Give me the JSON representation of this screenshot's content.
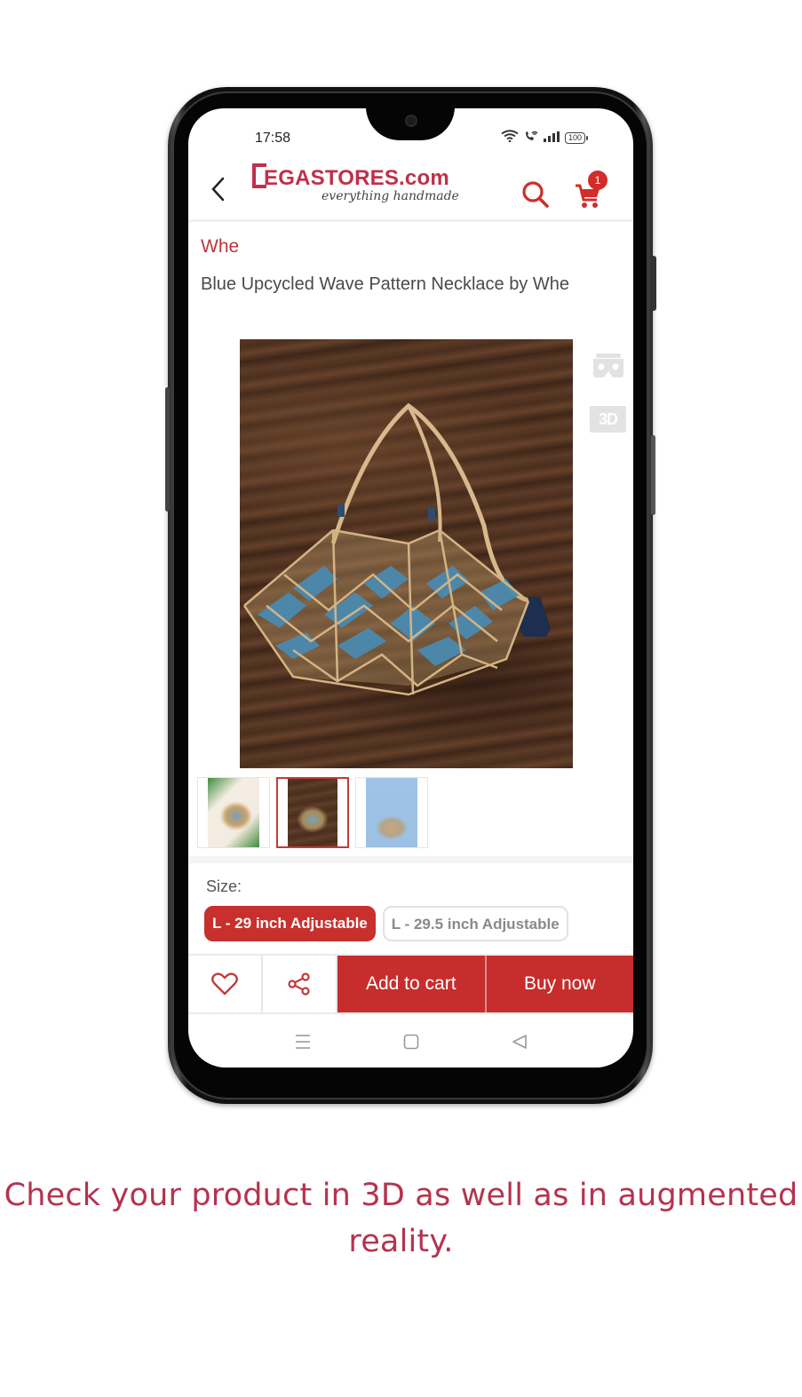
{
  "status_bar": {
    "time": "17:58",
    "battery": "100",
    "icons": [
      "wifi-icon",
      "wifi-calling-icon",
      "signal-icon",
      "battery-icon"
    ]
  },
  "header": {
    "logo_text": "EGASTORES.com",
    "logo_tagline": "everything handmade",
    "cart_count": "1",
    "icons": [
      "back-icon",
      "search-icon",
      "cart-icon"
    ]
  },
  "product": {
    "brand": "Whe",
    "title": "Blue Upcycled Wave Pattern Necklace by Whe",
    "image_description": "Blue and wood upcycled geometric wave-pattern necklace with tassel on a dark wood surface",
    "view_buttons": {
      "ar_icon": "vr-headset-icon",
      "three_d_label": "3D"
    },
    "thumbnails": [
      {
        "description": "Necklace on white background with green leaves",
        "selected": false
      },
      {
        "description": "Necklace on dark wood surface",
        "selected": true
      },
      {
        "description": "Necklace hanging on blue background",
        "selected": false
      }
    ]
  },
  "size": {
    "label": "Size:",
    "options": [
      {
        "label": "L - 29 inch Adjustable",
        "selected": true
      },
      {
        "label": "L - 29.5 inch Adjustable",
        "selected": false
      }
    ]
  },
  "actions": {
    "wishlist_icon": "heart-icon",
    "share_icon": "share-icon",
    "add_to_cart": "Add to cart",
    "buy_now": "Buy now"
  },
  "nav_bar": [
    "menu-icon",
    "home-icon",
    "back-triangle-icon"
  ],
  "caption": "Check your product in 3D as well as in augmented reality.",
  "colors": {
    "brand_red": "#c62d2c",
    "logo_red": "#c0304a",
    "caption_red": "#b5334f",
    "brand_text": "#b8373d"
  }
}
